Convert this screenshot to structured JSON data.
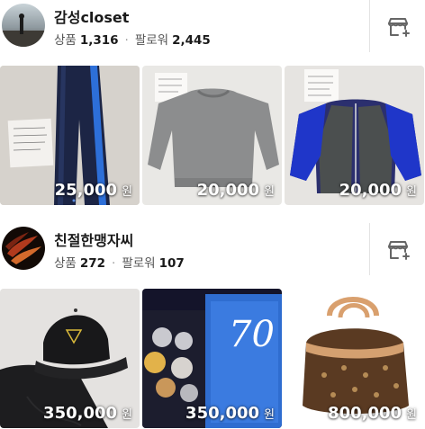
{
  "shops": [
    {
      "name": "감성closet",
      "products_label": "상품",
      "products_count": "1,316",
      "followers_label": "팔로워",
      "followers_count": "2,445",
      "items": [
        {
          "price": "25,000",
          "currency": "원"
        },
        {
          "price": "20,000",
          "currency": "원"
        },
        {
          "price": "20,000",
          "currency": "원"
        }
      ]
    },
    {
      "name": "친절한맹자씨",
      "products_label": "상품",
      "products_count": "272",
      "followers_label": "팔로워",
      "followers_count": "107",
      "items": [
        {
          "price": "350,000",
          "currency": "원"
        },
        {
          "price": "350,000",
          "currency": "원"
        },
        {
          "price": "800,000",
          "currency": "원"
        }
      ]
    }
  ],
  "photo_text": {
    "book_number": "70"
  },
  "colors": {
    "divider": "#e3e3e3",
    "icon": "#666666"
  },
  "icons": {
    "store": "store-icon",
    "separator": "dot"
  }
}
